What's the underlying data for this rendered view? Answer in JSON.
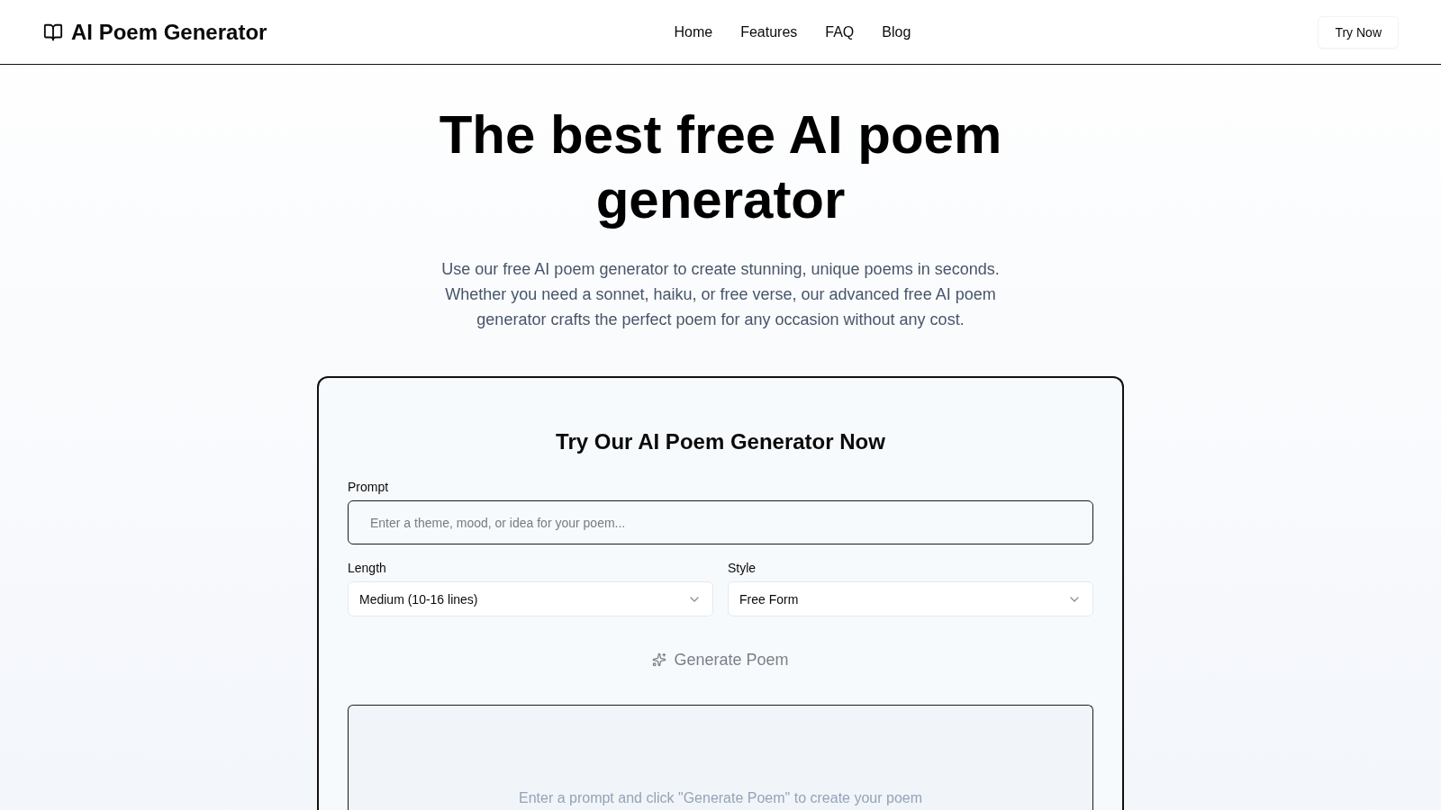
{
  "header": {
    "logo": "AI Poem Generator",
    "nav": [
      "Home",
      "Features",
      "FAQ",
      "Blog"
    ],
    "cta": "Try Now"
  },
  "hero": {
    "title": "The best free AI poem generator",
    "description": "Use our free AI poem generator to create stunning, unique poems in seconds. Whether you need a sonnet, haiku, or free verse, our advanced free AI poem generator crafts the perfect poem for any occasion without any cost."
  },
  "generator": {
    "title": "Try Our AI Poem Generator Now",
    "prompt": {
      "label": "Prompt",
      "placeholder": "Enter a theme, mood, or idea for your poem..."
    },
    "selects": [
      {
        "label": "Length",
        "value": "Medium (10-16 lines)"
      },
      {
        "label": "Style",
        "value": "Free Form"
      }
    ],
    "generate_button": {
      "label": "Generate Poem",
      "disabled": true
    },
    "output": {
      "empty_text": "Enter a prompt and click \"Generate Poem\" to create your poem"
    }
  }
}
